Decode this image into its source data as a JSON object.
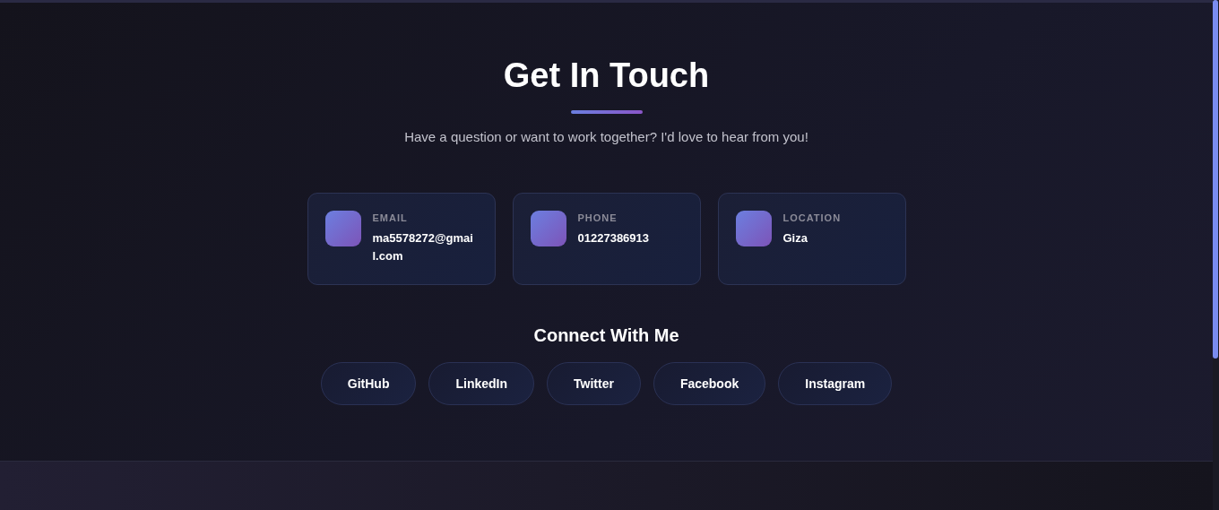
{
  "title": "Get In Touch",
  "subtitle": "Have a question or want to work together? I'd love to hear from you!",
  "contacts": [
    {
      "label": "EMAIL",
      "value": "ma5578272@gmai l.com"
    },
    {
      "label": "PHONE",
      "value": "01227386913"
    },
    {
      "label": "LOCATION",
      "value": "Giza"
    }
  ],
  "social_title": "Connect With Me",
  "social_links": [
    "GitHub",
    "LinkedIn",
    "Twitter",
    "Facebook",
    "Instagram"
  ]
}
